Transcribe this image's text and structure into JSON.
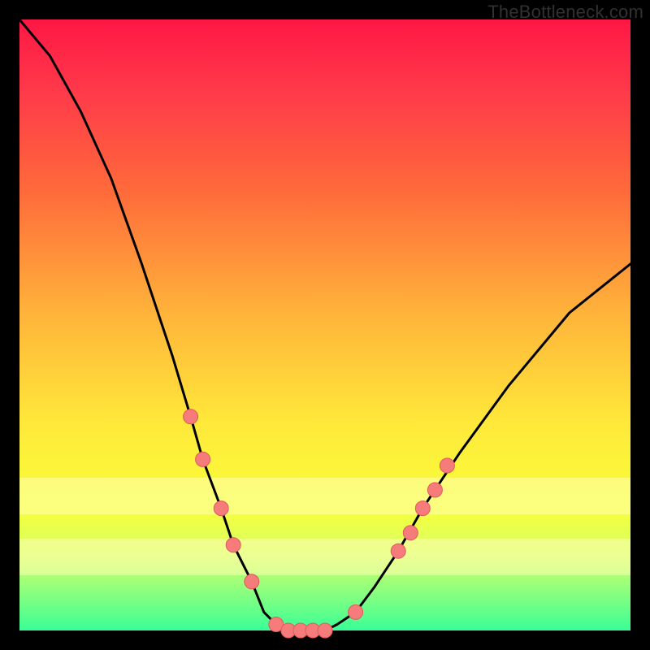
{
  "watermark": "TheBottleneck.com",
  "colors": {
    "frame_bg": "#000000",
    "curve": "#000000",
    "marker_fill": "#f67b7b",
    "marker_stroke": "#e05a5a"
  },
  "chart_data": {
    "type": "line",
    "title": "",
    "xlabel": "",
    "ylabel": "",
    "xlim": [
      0,
      100
    ],
    "ylim": [
      0,
      100
    ],
    "grid": false,
    "series": [
      {
        "name": "bottleneck-curve",
        "x": [
          0,
          5,
          10,
          15,
          20,
          22,
          25,
          28,
          30,
          33,
          35,
          38,
          40,
          42,
          44,
          46,
          48,
          50,
          52,
          55,
          58,
          62,
          66,
          72,
          80,
          90,
          100
        ],
        "y": [
          100,
          94,
          85,
          74,
          60,
          54,
          45,
          35,
          28,
          20,
          14,
          8,
          3,
          1,
          0,
          0,
          0,
          0,
          1,
          3,
          7,
          13,
          20,
          29,
          40,
          52,
          60
        ]
      }
    ],
    "markers": [
      {
        "x": 28,
        "y": 35
      },
      {
        "x": 30,
        "y": 28
      },
      {
        "x": 33,
        "y": 20
      },
      {
        "x": 35,
        "y": 14
      },
      {
        "x": 38,
        "y": 8
      },
      {
        "x": 42,
        "y": 1
      },
      {
        "x": 44,
        "y": 0
      },
      {
        "x": 46,
        "y": 0
      },
      {
        "x": 48,
        "y": 0
      },
      {
        "x": 50,
        "y": 0
      },
      {
        "x": 55,
        "y": 3
      },
      {
        "x": 62,
        "y": 13
      },
      {
        "x": 64,
        "y": 16
      },
      {
        "x": 66,
        "y": 20
      },
      {
        "x": 68,
        "y": 23
      },
      {
        "x": 70,
        "y": 27
      }
    ],
    "yellow_bands": [
      {
        "y_center": 22,
        "height": 6
      },
      {
        "y_center": 12,
        "height": 6
      }
    ],
    "marker_radius": 1.2
  }
}
